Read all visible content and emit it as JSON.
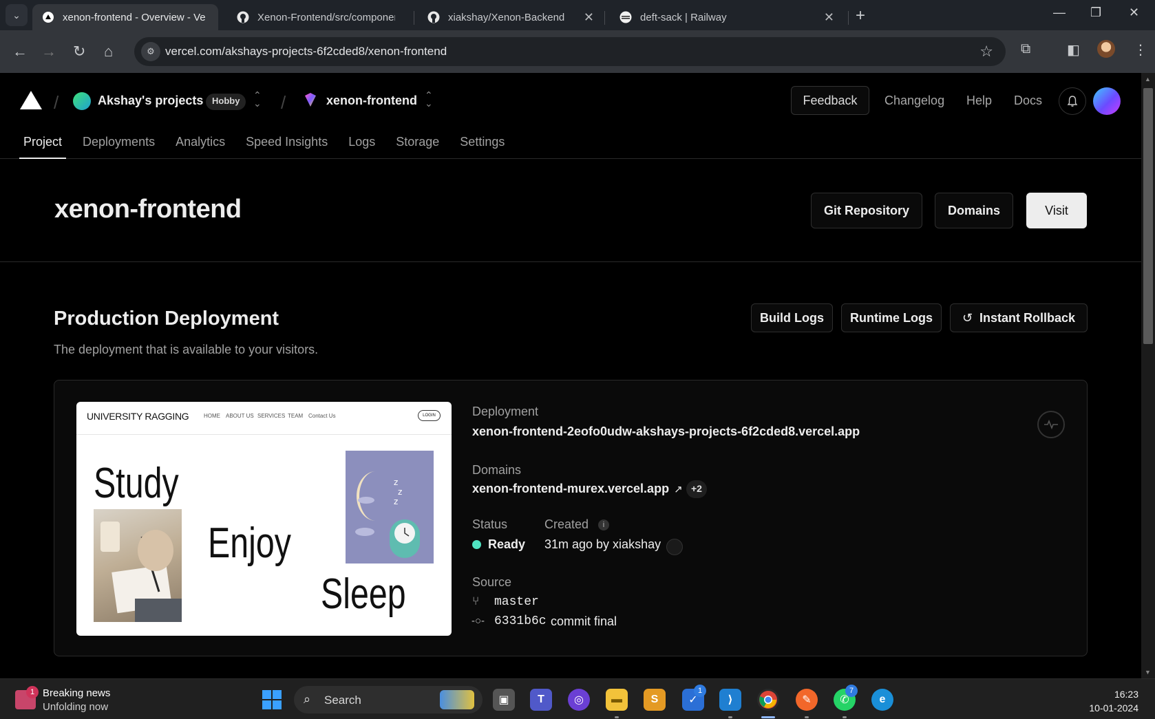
{
  "browser": {
    "tabs": [
      {
        "title": "xenon-frontend - Overview - Ve",
        "icon": "vercel-icon",
        "active": true
      },
      {
        "title": "Xenon-Frontend/src/componen",
        "icon": "github-icon",
        "active": false
      },
      {
        "title": "xiakshay/Xenon-Backend",
        "icon": "github-icon",
        "active": false
      },
      {
        "title": "deft-sack | Railway",
        "icon": "railway-icon",
        "active": false
      }
    ],
    "url": "vercel.com/akshays-projects-6f2cded8/xenon-frontend"
  },
  "header": {
    "team_name": "Akshay's projects",
    "plan_badge": "Hobby",
    "project_name": "xenon-frontend",
    "feedback": "Feedback",
    "links": [
      "Changelog",
      "Help",
      "Docs"
    ]
  },
  "subnav": [
    "Project",
    "Deployments",
    "Analytics",
    "Speed Insights",
    "Logs",
    "Storage",
    "Settings"
  ],
  "project": {
    "title": "xenon-frontend",
    "buttons": {
      "git": "Git Repository",
      "domains": "Domains",
      "visit": "Visit"
    }
  },
  "production": {
    "title": "Production Deployment",
    "subtitle": "The deployment that is available to your visitors.",
    "buttons": {
      "build_logs": "Build Logs",
      "runtime_logs": "Runtime Logs",
      "rollback": "Instant Rollback"
    },
    "deployment_label": "Deployment",
    "deployment_url": "xenon-frontend-2eofo0udw-akshays-projects-6f2cded8.vercel.app",
    "domains_label": "Domains",
    "domain": "xenon-frontend-murex.vercel.app",
    "domains_more": "+2",
    "status_label": "Status",
    "status_value": "Ready",
    "status_color": "#50e3c2",
    "created_label": "Created",
    "created_value": "31m ago by xiakshay",
    "source_label": "Source",
    "branch": "master",
    "commit_hash": "6331b6c",
    "commit_message": "commit final"
  },
  "preview": {
    "brand": "UNIVERSITY RAGGING",
    "nav": [
      "HOME",
      "ABOUT US",
      "SERVICES",
      "TEAM",
      "Contact Us"
    ],
    "login": "LOGIN",
    "words": [
      "Study",
      "Enjoy",
      "Sleep"
    ]
  },
  "taskbar": {
    "news_title": "Breaking news",
    "news_sub": "Unfolding now",
    "news_badge": "1",
    "search": "Search",
    "badges": {
      "tasks": "1",
      "whatsapp": "7"
    },
    "time": "16:23",
    "date": "10-01-2024"
  }
}
